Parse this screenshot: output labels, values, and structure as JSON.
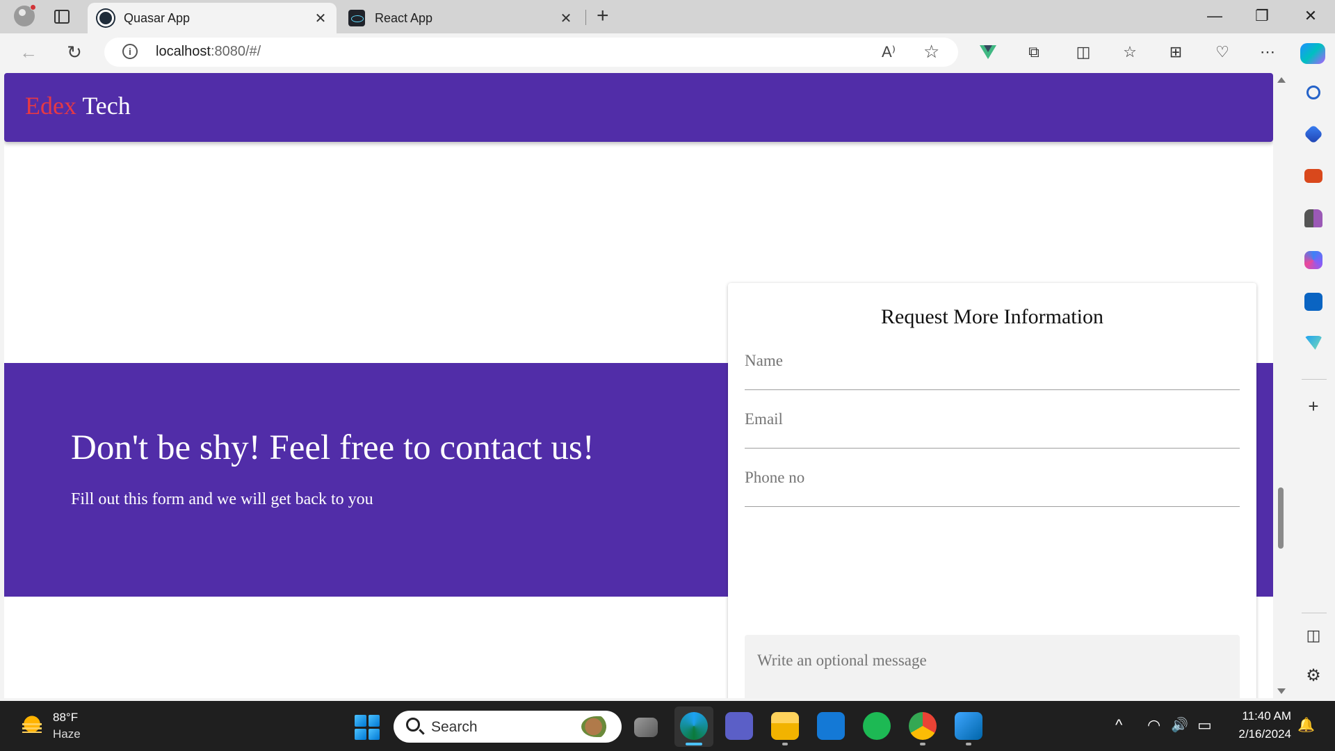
{
  "browser": {
    "tabs": [
      {
        "title": "Quasar App",
        "active": true
      },
      {
        "title": "React App",
        "active": false
      }
    ],
    "close_glyph": "✕",
    "new_tab_glyph": "+",
    "window_controls": {
      "minimize": "—",
      "restore": "❐",
      "close": "✕"
    },
    "address": {
      "host": "localhost",
      "rest": ":8080/#/"
    },
    "read_aloud_glyph": "A⁾",
    "favorite_glyph": "☆",
    "toolbar_glyphs": {
      "extensions": "⧉",
      "split": "◫",
      "favorites": "☆",
      "collections": "⊞",
      "health": "♡",
      "more": "⋯"
    },
    "back_glyph": "←",
    "refresh_glyph": "↻"
  },
  "page": {
    "brand": {
      "part1": "Edex",
      "part2": "Tech"
    },
    "cta": {
      "title": "Don't be shy! Feel free to contact us!",
      "subtitle": "Fill out this form and we will get back to you"
    },
    "form": {
      "title": "Request More Information",
      "name_placeholder": "Name",
      "email_placeholder": "Email",
      "phone_placeholder": "Phone no",
      "message_placeholder": "Write an optional message"
    }
  },
  "sidebar": {
    "icons": [
      "search-icon",
      "shopping-tag-icon",
      "toolbox-icon",
      "chess-icon",
      "microsoft365-icon",
      "outlook-icon",
      "send-icon"
    ],
    "add_glyph": "+",
    "bottom_glyphs": {
      "panel": "◫",
      "settings": "⚙"
    }
  },
  "taskbar": {
    "weather": {
      "temp": "88°F",
      "desc": "Haze"
    },
    "search_label": "Search",
    "clock": {
      "time": "11:40 AM",
      "date": "2/16/2024"
    },
    "tray_glyphs": {
      "chevron": "^",
      "wifi": "◠",
      "volume": "🔊",
      "battery": "▭",
      "bell": "🔔"
    }
  },
  "colors": {
    "primary": "#512da8",
    "brand_accent": "#e53945",
    "taskbar": "#1f1f1f"
  }
}
